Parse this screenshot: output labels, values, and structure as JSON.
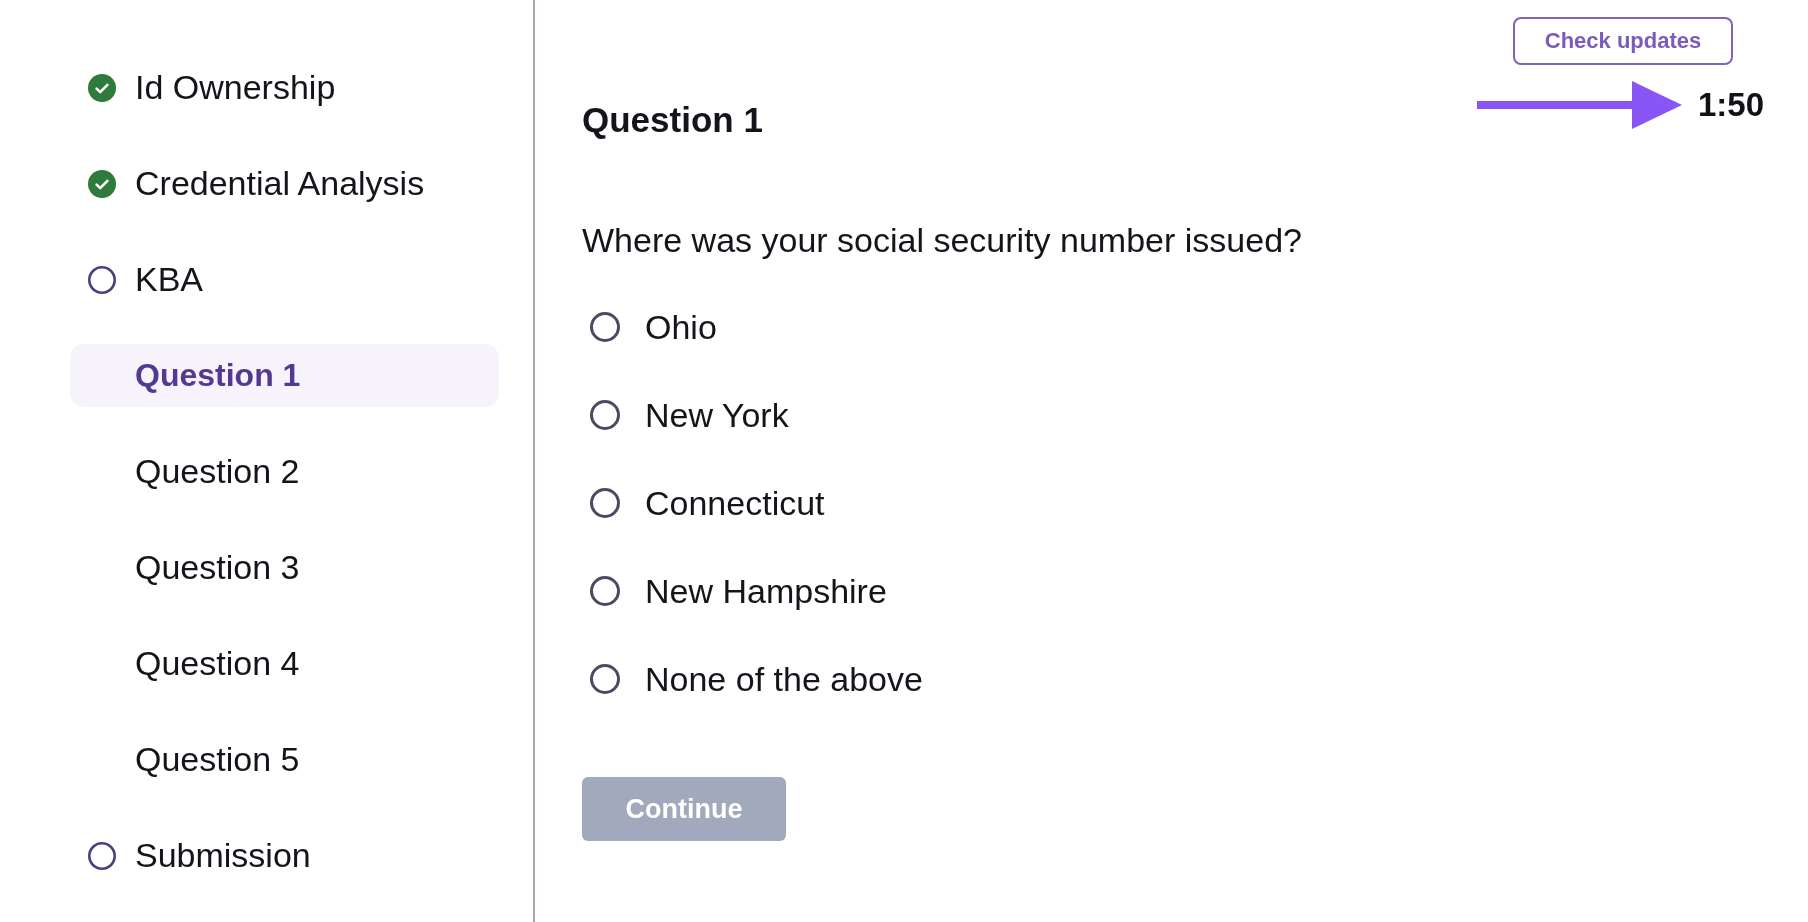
{
  "sidebar": {
    "items": [
      {
        "label": "Id Ownership",
        "kind": "step",
        "done": true,
        "selected": false
      },
      {
        "label": "Credential Analysis",
        "kind": "step",
        "done": true,
        "selected": false
      },
      {
        "label": "KBA",
        "kind": "step",
        "done": false,
        "selected": false
      },
      {
        "label": "Question 1",
        "kind": "question",
        "selected": true
      },
      {
        "label": "Question 2",
        "kind": "question",
        "selected": false
      },
      {
        "label": "Question 3",
        "kind": "question",
        "selected": false
      },
      {
        "label": "Question 4",
        "kind": "question",
        "selected": false
      },
      {
        "label": "Question 5",
        "kind": "question",
        "selected": false
      },
      {
        "label": "Submission",
        "kind": "step",
        "done": false,
        "selected": false
      }
    ]
  },
  "header": {
    "check_updates_button": "Check updates",
    "timer": "1:50"
  },
  "question": {
    "title": "Question 1",
    "text": "Where was your social security number issued?",
    "options": [
      {
        "label": "Ohio",
        "selected": false
      },
      {
        "label": "New York",
        "selected": false
      },
      {
        "label": "Connecticut",
        "selected": false
      },
      {
        "label": "New Hampshire",
        "selected": false
      },
      {
        "label": "None of the above",
        "selected": false
      }
    ]
  },
  "continue_button": {
    "label": "Continue",
    "disabled": true
  }
}
